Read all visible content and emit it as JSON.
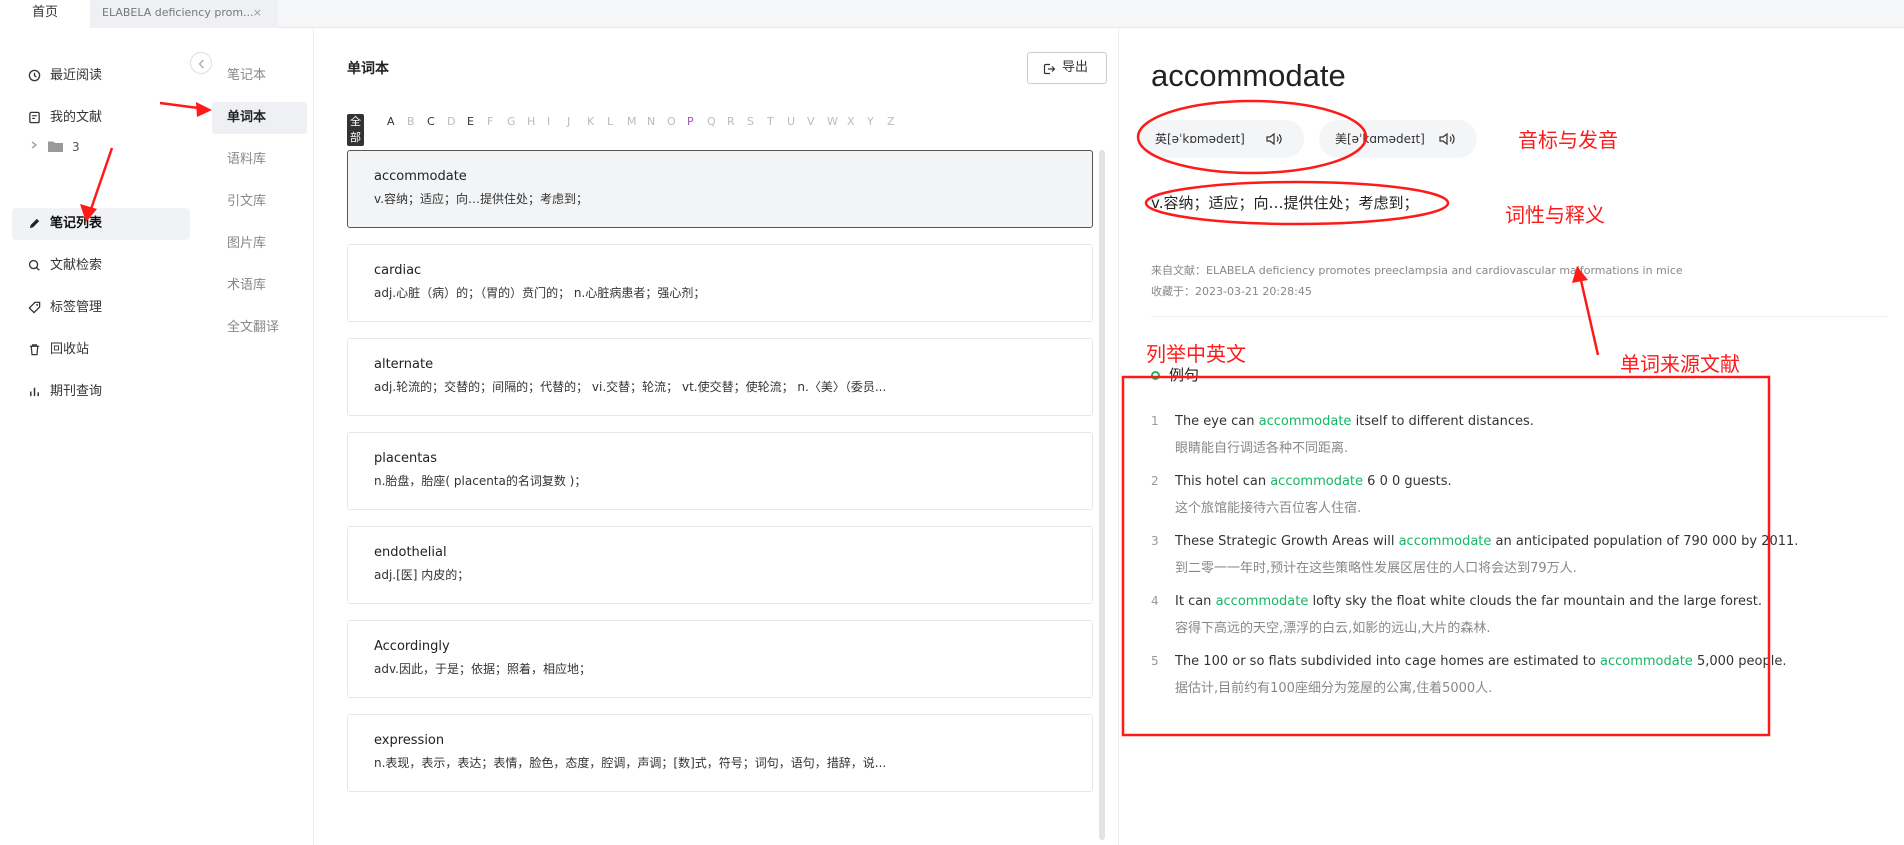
{
  "tabs": {
    "home": "首页",
    "doc": "ELABELA deficiency prom...",
    "doc_close": "×"
  },
  "sidebar": {
    "items": [
      {
        "label": "最近阅读",
        "icon": "clock-icon"
      },
      {
        "label": "我的文献",
        "icon": "document-icon"
      },
      {
        "label": "笔记列表",
        "icon": "pen-icon",
        "active": true
      },
      {
        "label": "文献检索",
        "icon": "search-icon"
      },
      {
        "label": "标签管理",
        "icon": "tag-icon"
      },
      {
        "label": "回收站",
        "icon": "trash-icon"
      },
      {
        "label": "期刊查询",
        "icon": "bar-chart-icon"
      }
    ],
    "folder_count": "3"
  },
  "subnav": {
    "items": [
      "笔记本",
      "单词本",
      "语料库",
      "引文库",
      "图片库",
      "术语库",
      "全文翻译"
    ],
    "active_index": 1
  },
  "list": {
    "title": "单词本",
    "export_label": "导出",
    "alphabet": [
      "全部",
      "A",
      "B",
      "C",
      "D",
      "E",
      "F",
      "G",
      "H",
      "I",
      "J",
      "K",
      "L",
      "M",
      "N",
      "O",
      "P",
      "Q",
      "R",
      "S",
      "T",
      "U",
      "V",
      "W",
      "X",
      "Y",
      "Z"
    ],
    "words": [
      {
        "word": "accommodate",
        "def": "v.容纳；适应；向…提供住处；考虑到；"
      },
      {
        "word": "cardiac",
        "def": "adj.心脏（病）的；（胃的）贲门的； n.心脏病患者；强心剂；"
      },
      {
        "word": "alternate",
        "def": "adj.轮流的；交替的；间隔的；代替的； vi.交替；轮流； vt.使交替；使轮流； n.〈美〉（委员..."
      },
      {
        "word": "placentas",
        "def": "n.胎盘，胎座( placenta的名词复数 )；"
      },
      {
        "word": "endothelial",
        "def": "adj.[医] 内皮的；"
      },
      {
        "word": "Accordingly",
        "def": "adv.因此，于是；依据；照着，相应地；"
      },
      {
        "word": "expression",
        "def": "n.表现，表示，表达；表情，脸色，态度，腔调，声调；[数]式，符号；词句，语句，措辞，说..."
      }
    ]
  },
  "detail": {
    "word": "accommodate",
    "pron_uk": "英[əˈkɒmədeɪt]",
    "pron_us": "美[əˈkɑmədeɪt]",
    "definition": "v.容纳；适应；向…提供住处；考虑到；",
    "source": "来自文献：ELABELA deficiency promotes preeclampsia and cardiovascular malformations in mice",
    "saved": "收藏于：2023-03-21 20:28:45",
    "examples_title": "例句",
    "examples": [
      {
        "num": "1",
        "pre": "The eye can ",
        "hl": "accommodate",
        "post": " itself to different distances.",
        "zh": "眼睛能自行调适各种不同距离."
      },
      {
        "num": "2",
        "pre": "This hotel can ",
        "hl": "accommodate",
        "post": " 6 0 0 guests.",
        "zh": "这个旅馆能接待六百位客人住宿."
      },
      {
        "num": "3",
        "pre": "These Strategic Growth Areas will ",
        "hl": "accommodate",
        "post": " an anticipated population of 790 000 by 2011.",
        "zh": "到二零一一年时,预计在这些策略性发展区居住的人口将会达到79万人."
      },
      {
        "num": "4",
        "pre": "It can ",
        "hl": "accommodate",
        "post": " lofty sky the float white clouds the far mountain and the large forest.",
        "zh": "容得下高远的天空,漂浮的白云,如影的远山,大片的森林."
      },
      {
        "num": "5",
        "pre": "The 100 or so flats subdivided into cage homes are estimated to ",
        "hl": "accommodate",
        "post": " 5,000 people.",
        "zh": "据估计,目前约有100座细分为笼屋的公寓,住着5000人."
      }
    ]
  },
  "annotations": {
    "pron": "音标与发音",
    "def": "词性与释义",
    "list": "列举中英文",
    "source": "单词来源文献"
  },
  "colors": {
    "accent": "#18b566",
    "annotation": "#ff1a1a",
    "selected_letter": "#9b59b6"
  }
}
